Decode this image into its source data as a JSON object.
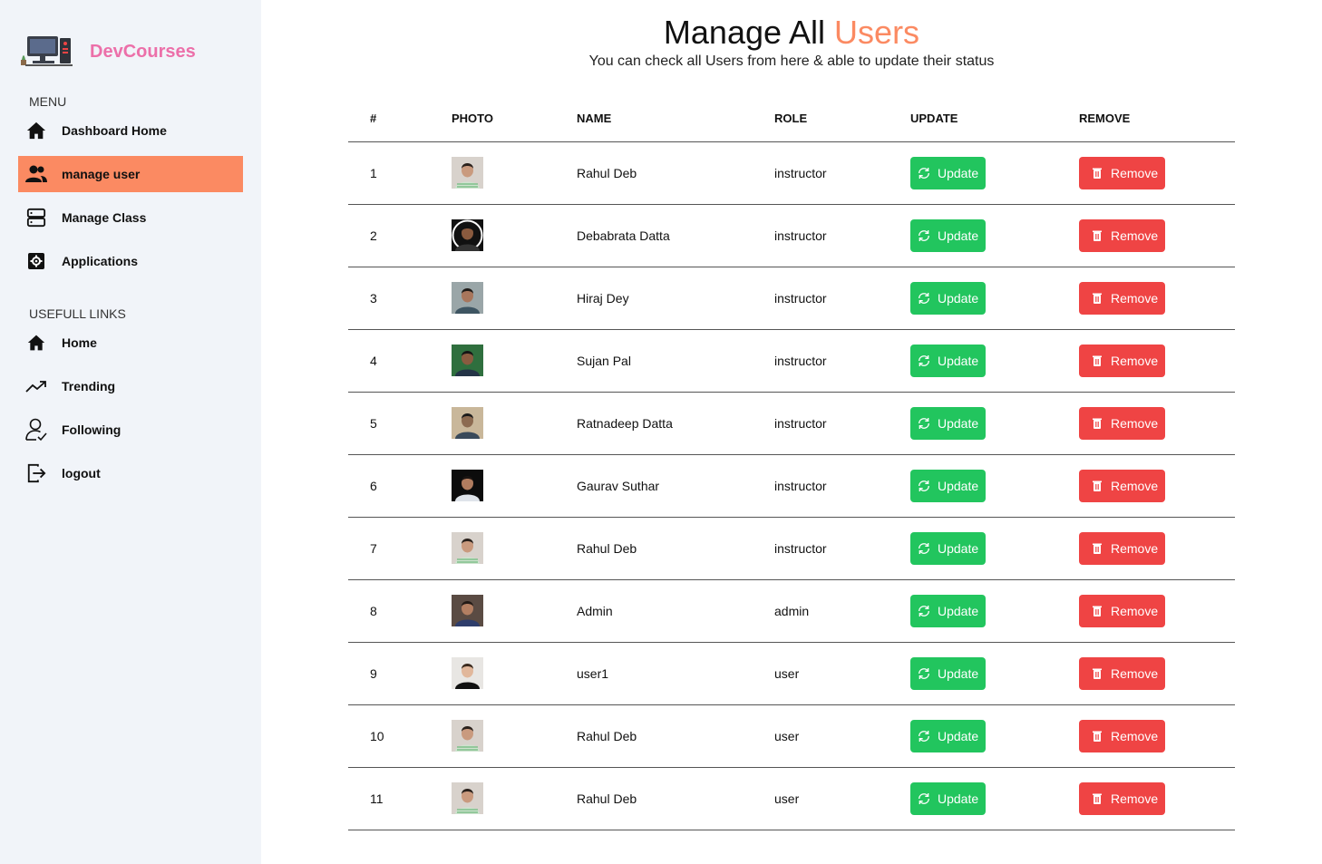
{
  "brand": {
    "name": "DevCourses"
  },
  "sidebar": {
    "menu_title": "MENU",
    "menu_items": [
      {
        "label": "Dashboard Home",
        "icon": "home-icon",
        "active": false
      },
      {
        "label": "manage user",
        "icon": "users-icon",
        "active": true
      },
      {
        "label": "Manage Class",
        "icon": "server-icon",
        "active": false
      },
      {
        "label": "Applications",
        "icon": "cog-box-icon",
        "active": false
      }
    ],
    "links_title": "USEFULL LINKS",
    "link_items": [
      {
        "label": "Home",
        "icon": "home-icon"
      },
      {
        "label": "Trending",
        "icon": "trending-icon"
      },
      {
        "label": "Following",
        "icon": "user-check-icon"
      },
      {
        "label": "logout",
        "icon": "logout-icon"
      }
    ]
  },
  "header": {
    "title_prefix": "Manage All ",
    "title_accent": "Users",
    "subtitle": "You can check all Users from here & able to update their status"
  },
  "table": {
    "columns": [
      "#",
      "PHOTO",
      "NAME",
      "ROLE",
      "UPDATE",
      "REMOVE"
    ],
    "update_label": "Update",
    "remove_label": "Remove",
    "rows": [
      {
        "index": "1",
        "name": "Rahul Deb",
        "role": "instructor",
        "photo": "rahul"
      },
      {
        "index": "2",
        "name": "Debabrata Datta",
        "role": "instructor",
        "photo": "debabrata"
      },
      {
        "index": "3",
        "name": "Hiraj Dey",
        "role": "instructor",
        "photo": "hiraj"
      },
      {
        "index": "4",
        "name": "Sujan Pal",
        "role": "instructor",
        "photo": "sujan"
      },
      {
        "index": "5",
        "name": "Ratnadeep Datta",
        "role": "instructor",
        "photo": "ratnadeep"
      },
      {
        "index": "6",
        "name": "Gaurav Suthar",
        "role": "instructor",
        "photo": "gaurav"
      },
      {
        "index": "7",
        "name": "Rahul Deb",
        "role": "instructor",
        "photo": "rahul"
      },
      {
        "index": "8",
        "name": "Admin",
        "role": "admin",
        "photo": "admin"
      },
      {
        "index": "9",
        "name": "user1",
        "role": "user",
        "photo": "user1"
      },
      {
        "index": "10",
        "name": "Rahul Deb",
        "role": "user",
        "photo": "rahul"
      },
      {
        "index": "11",
        "name": "Rahul Deb",
        "role": "user",
        "photo": "rahul"
      }
    ]
  },
  "colors": {
    "accent": "#fb8a62",
    "brand": "#ec6fa9",
    "sidebar_bg": "#f1f4f9",
    "update_btn": "#22c55e",
    "remove_btn": "#ef4444"
  }
}
